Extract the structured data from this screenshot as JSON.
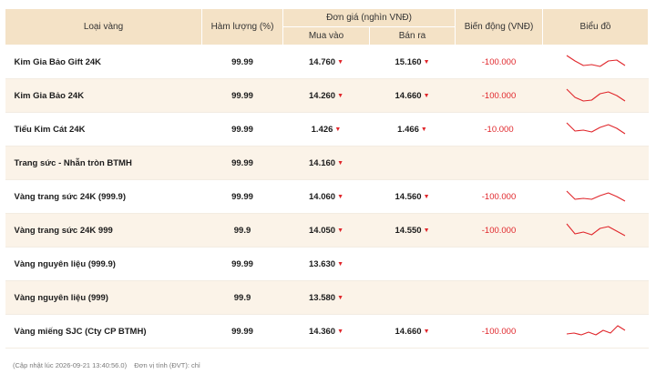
{
  "header": {
    "col_type": "Loại vàng",
    "col_purity": "Hàm lượng (%)",
    "col_price_group": "Đơn giá (nghìn VNĐ)",
    "col_buy": "Mua vào",
    "col_sell": "Bán ra",
    "col_change": "Biến động (VNĐ)",
    "col_chart": "Biểu đồ"
  },
  "colors": {
    "header_bg": "#f4e2c6",
    "alt_row_bg": "#fbf3e8",
    "down": "#e0262b"
  },
  "rows": [
    {
      "name": "Kim Gia Bảo Gift 24K",
      "purity": "99.99",
      "buy": "14.760",
      "sell": "15.160",
      "change": "-100.000",
      "trend": [
        0.85,
        0.55,
        0.3,
        0.35,
        0.25,
        0.55,
        0.6,
        0.3
      ]
    },
    {
      "name": "Kim Gia Bảo 24K",
      "purity": "99.99",
      "buy": "14.260",
      "sell": "14.660",
      "change": "-100.000",
      "trend": [
        0.85,
        0.4,
        0.2,
        0.25,
        0.6,
        0.7,
        0.5,
        0.2
      ]
    },
    {
      "name": "Tiểu Kim Cát 24K",
      "purity": "99.99",
      "buy": "1.426",
      "sell": "1.466",
      "change": "-10.000",
      "trend": [
        0.85,
        0.4,
        0.45,
        0.35,
        0.6,
        0.75,
        0.55,
        0.25
      ]
    },
    {
      "name": "Trang sức - Nhẫn tròn BTMH",
      "purity": "99.99",
      "buy": "14.160",
      "sell": "",
      "change": "",
      "trend": []
    },
    {
      "name": "Vàng trang sức 24K (999.9)",
      "purity": "99.99",
      "buy": "14.060",
      "sell": "14.560",
      "change": "-100.000",
      "trend": [
        0.8,
        0.35,
        0.4,
        0.35,
        0.55,
        0.7,
        0.5,
        0.25
      ]
    },
    {
      "name": "Vàng trang sức 24K 999",
      "purity": "99.9",
      "buy": "14.050",
      "sell": "14.550",
      "change": "-100.000",
      "trend": [
        0.85,
        0.3,
        0.4,
        0.25,
        0.6,
        0.7,
        0.45,
        0.2
      ]
    },
    {
      "name": "Vàng nguyên liệu (999.9)",
      "purity": "99.99",
      "buy": "13.630",
      "sell": "",
      "change": "",
      "trend": []
    },
    {
      "name": "Vàng nguyên liệu (999)",
      "purity": "99.9",
      "buy": "13.580",
      "sell": "",
      "change": "",
      "trend": []
    },
    {
      "name": "Vàng miếng SJC (Cty CP BTMH)",
      "purity": "99.99",
      "buy": "14.360",
      "sell": "14.660",
      "change": "-100.000",
      "trend": [
        0.35,
        0.4,
        0.3,
        0.45,
        0.3,
        0.55,
        0.4,
        0.8,
        0.55
      ]
    }
  ],
  "footer": {
    "updated": "(Cập nhật lúc 2026-09-21 13:40:56.0)",
    "unit": "Đơn vị tính (ĐVT): chỉ"
  }
}
